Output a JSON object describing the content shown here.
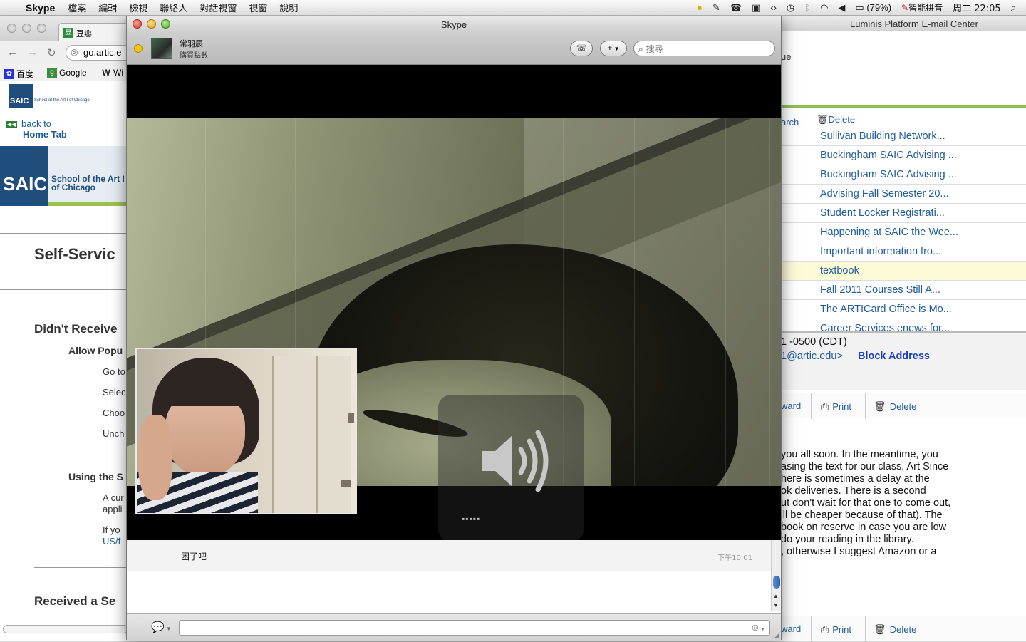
{
  "menubar": {
    "app": "Skype",
    "items": [
      "檔案",
      "編輯",
      "檢視",
      "聯絡人",
      "對話視窗",
      "視窗",
      "說明"
    ],
    "battery": "(79%)",
    "input_method": "智能拼音",
    "clock": "周二 22:05"
  },
  "browser": {
    "tab_title": "豆瓣",
    "url": "go.artic.e",
    "bookmarks": [
      "百度",
      "Google",
      "Wi"
    ],
    "back_to": "back to",
    "home_tab": "Home Tab",
    "logo_text": "SAIC",
    "logo_subtitle_1": "School of the Art I",
    "logo_subtitle_2": "of Chicago",
    "page_title": "Self-Servic",
    "section_1": "Didn't Receive",
    "sub_1": "Allow Popu",
    "steps": [
      "Go to",
      "Selec",
      "Choo",
      "Unch"
    ],
    "sub_2": "Using the S",
    "para_1a": "A cur",
    "para_1b": "appli",
    "para_2a": "If yo",
    "para_2b": "US/f",
    "section_2": "Received a Se"
  },
  "email": {
    "window_title": "Luminis Platform E-mail Center",
    "top_fragment": "ue",
    "toolbar_search": "arch",
    "toolbar_delete": "Delete",
    "messages": [
      "Sullivan Building Network...",
      "Buckingham SAIC Advising ...",
      "Buckingham SAIC Advising ...",
      "Advising Fall Semester 20...",
      "Student Locker Registrati...",
      "Happening at SAIC the Wee...",
      "Important information fro...",
      "textbook",
      "Fall 2011 Courses Still A...",
      "The ARTICard Office is Mo...",
      "Career Services enews for..."
    ],
    "selected_index": 7,
    "date": "1 -0500 (CDT)",
    "from": "1@artic.edu>",
    "block": "Block Address",
    "forward": "ward",
    "print": "Print",
    "delete": "Delete",
    "body": [
      "you all soon. In the meantime, you",
      "asing the text for our class, Art Since",
      "here is sometimes a delay at the",
      "ok deliveries.  There is a second",
      "ut don't wait for that one to come out,",
      "'ll be cheaper because of that). The",
      "book on reserve in case you are low",
      "do your reading in the library.",
      ", otherwise I suggest Amazon or a"
    ]
  },
  "skype": {
    "window_title": "Skype",
    "contact_name": "常羽辰",
    "contact_mood": "購買點數",
    "search_placeholder": "搜尋",
    "call_icon": "dialpad-icon",
    "add_label": "+",
    "volume_dots": "▪▪▪▪▪",
    "chat": {
      "message": "困了吧",
      "time": "下午10:01"
    },
    "accent": "#2e63b3"
  }
}
